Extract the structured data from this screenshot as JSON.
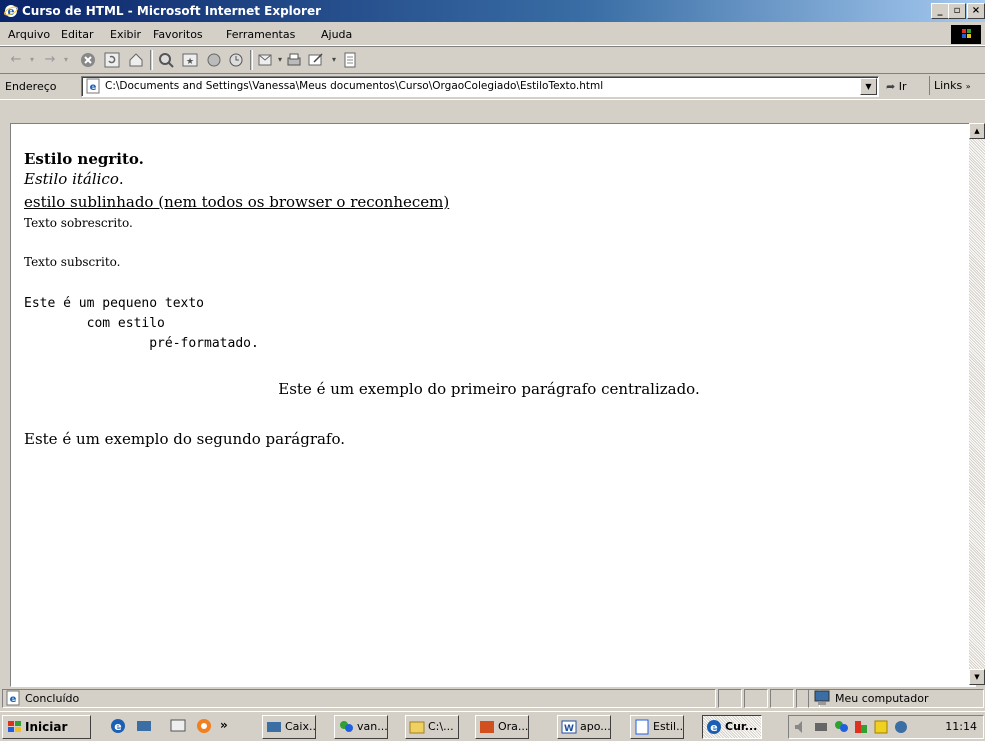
{
  "window": {
    "title": "Curso de HTML - Microsoft Internet Explorer"
  },
  "menu": [
    "Arquivo",
    "Editar",
    "Exibir",
    "Favoritos",
    "Ferramentas",
    "Ajuda"
  ],
  "address": {
    "label": "Endereço",
    "value": "C:\\Documents and Settings\\Vanessa\\Meus documentos\\Curso\\OrgaoColegiado\\EstiloTexto.html",
    "go_label": "Ir",
    "links_label": "Links"
  },
  "page": {
    "bold": "Estilo negrito.",
    "italic": "Estilo itálico",
    "italic_end": ".",
    "underline": "estilo sublinhado (nem todos os browser o reconhecem)",
    "superscript": "Texto sobrescrito.",
    "subscript": "Texto subscrito.",
    "pre_line1": "Este é um pequeno texto",
    "pre_line2": "        com estilo",
    "pre_line3": "                pré-formatado.",
    "centered": "Este é um exemplo do primeiro parágrafo centralizado.",
    "paragraph2": "Este é um exemplo do segundo parágrafo."
  },
  "status": {
    "text": "Concluído",
    "zone": "Meu computador"
  },
  "taskbar": {
    "start_label": "Iniciar",
    "chevron": "»",
    "buttons": [
      "Caix...",
      "van...",
      "C:\\...",
      "Ora...",
      "apo...",
      "Estil...",
      "Cur..."
    ],
    "clock": "11:14"
  },
  "icons": {
    "title": "ie-icon",
    "toolbar": [
      "back-icon",
      "forward-icon",
      "stop-icon",
      "refresh-icon",
      "home-icon",
      "search-icon",
      "favorites-icon",
      "media-icon",
      "history-icon",
      "mail-icon",
      "print-icon",
      "edit-icon",
      "discuss-icon"
    ]
  }
}
